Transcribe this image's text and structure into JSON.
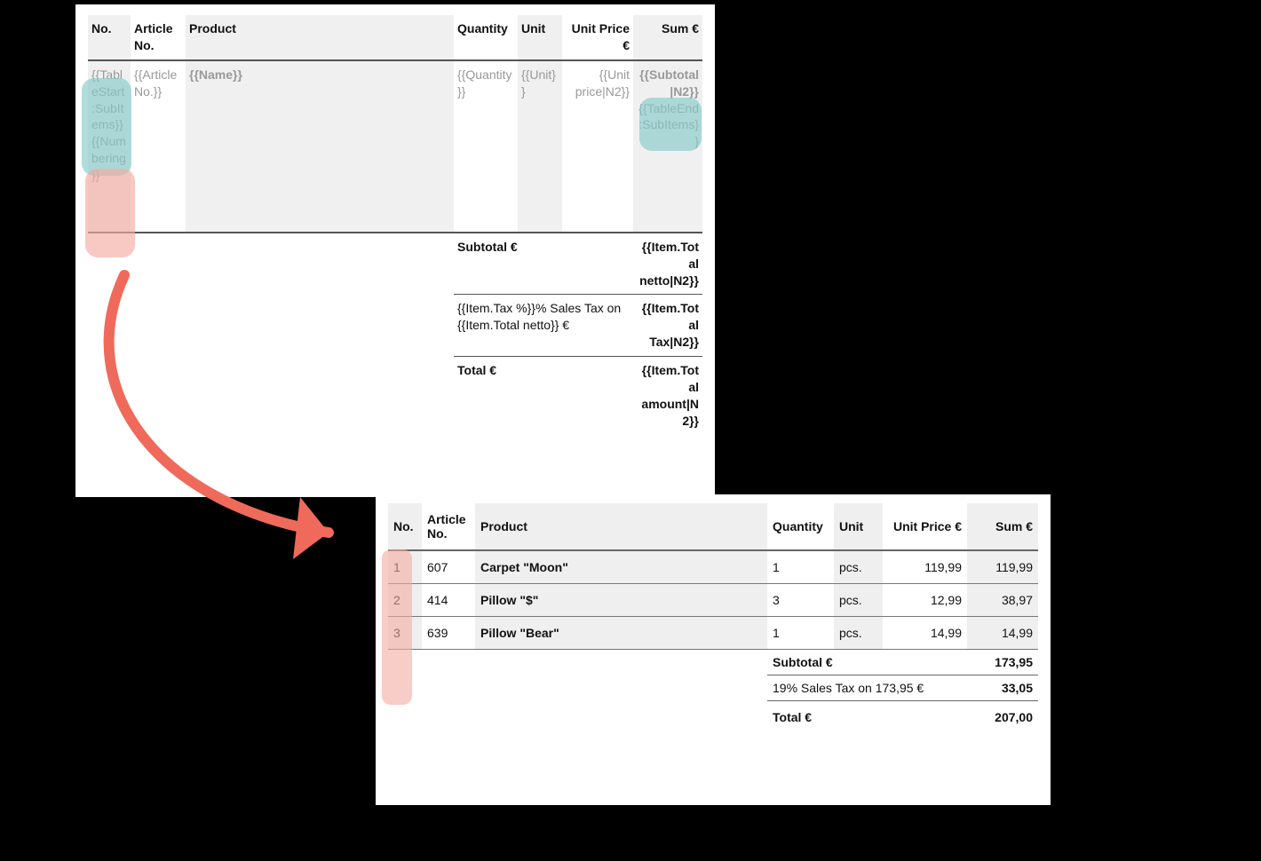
{
  "colors": {
    "accent_red": "#ef6a5a",
    "teal_highlight": "#87c9c9",
    "pink_highlight": "#f4aaa2"
  },
  "template": {
    "header": {
      "no": "No.",
      "article_no": "Article No.",
      "product": "Product",
      "quantity": "Quantity",
      "unit": "Unit",
      "unit_price": "Unit Price €",
      "sum": "Sum €"
    },
    "row": {
      "no_part1": "{{TableStart:SubItems}}",
      "no_part2": "{{Numbering}}",
      "article": "{{Article No.}}",
      "name": "{{Name}}",
      "quantity": "{{Quantity}}",
      "unit": "{{Unit}}",
      "unit_price": "{{Unit price|N2}}",
      "subtotal": "{{Subtotal|N2}}",
      "table_end": "{{TableEnd:SubItems}}"
    },
    "totals": {
      "subtotal_label": "Subtotal €",
      "subtotal_value": "{{Item.Total netto|N2}}",
      "tax_label": "{{Item.Tax %}}% Sales Tax on {{Item.Total netto}} €",
      "tax_value": "{{Item.Total Tax|N2}}",
      "total_label": "Total €",
      "total_value": "{{Item.Total amount|N2}}"
    }
  },
  "rendered": {
    "header": {
      "no": "No.",
      "article_no": "Article No.",
      "product": "Product",
      "quantity": "Quantity",
      "unit": "Unit",
      "unit_price": "Unit Price €",
      "sum": "Sum €"
    },
    "items": [
      {
        "no": "1",
        "article": "607",
        "name": "Carpet \"Moon\"",
        "qty": "1",
        "unit": "pcs.",
        "uprice": "119,99",
        "sum": "119,99"
      },
      {
        "no": "2",
        "article": "414",
        "name": "Pillow \"$\"",
        "qty": "3",
        "unit": "pcs.",
        "uprice": "12,99",
        "sum": "38,97"
      },
      {
        "no": "3",
        "article": "639",
        "name": "Pillow \"Bear\"",
        "qty": "1",
        "unit": "pcs.",
        "uprice": "14,99",
        "sum": "14,99"
      }
    ],
    "totals": {
      "subtotal_label": "Subtotal €",
      "subtotal_value": "173,95",
      "tax_label": "19% Sales Tax on 173,95 €",
      "tax_value": "33,05",
      "total_label": "Total €",
      "total_value": "207,00"
    }
  }
}
